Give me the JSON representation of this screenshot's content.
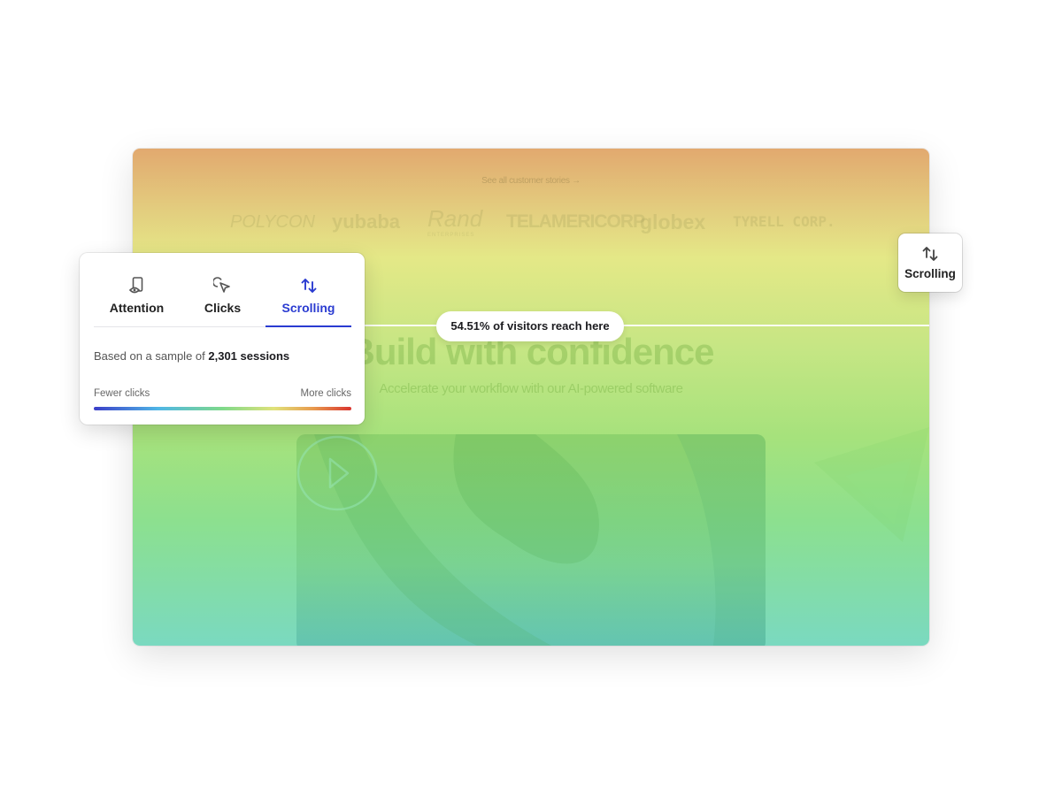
{
  "preview": {
    "stories_link": "See all customer stories →",
    "logos": [
      "POLYCON",
      "yubaba",
      "Rand",
      "ENTERPRISES",
      "TELAMERICORP",
      "globex",
      "TYRELL CORP."
    ],
    "headline": "Build with confidence",
    "subheadline": "Accelerate your workflow with our AI-powered software",
    "play_icon": "play-icon"
  },
  "scroll_marker": {
    "percent": 54.51,
    "label": "54.51% of visitors reach here"
  },
  "panel": {
    "tabs": [
      {
        "label": "Attention",
        "icon": "attention-icon",
        "active": false
      },
      {
        "label": "Clicks",
        "icon": "cursor-click-icon",
        "active": false
      },
      {
        "label": "Scrolling",
        "icon": "arrows-up-down-icon",
        "active": true
      }
    ],
    "sample_prefix": "Based on a sample of",
    "sample_value": "2,301 sessions",
    "legend_low": "Fewer clicks",
    "legend_high": "More clicks",
    "accent_color": "#2a3bd1"
  },
  "mode_button": {
    "label": "Scrolling",
    "icon": "arrows-up-down-icon"
  }
}
